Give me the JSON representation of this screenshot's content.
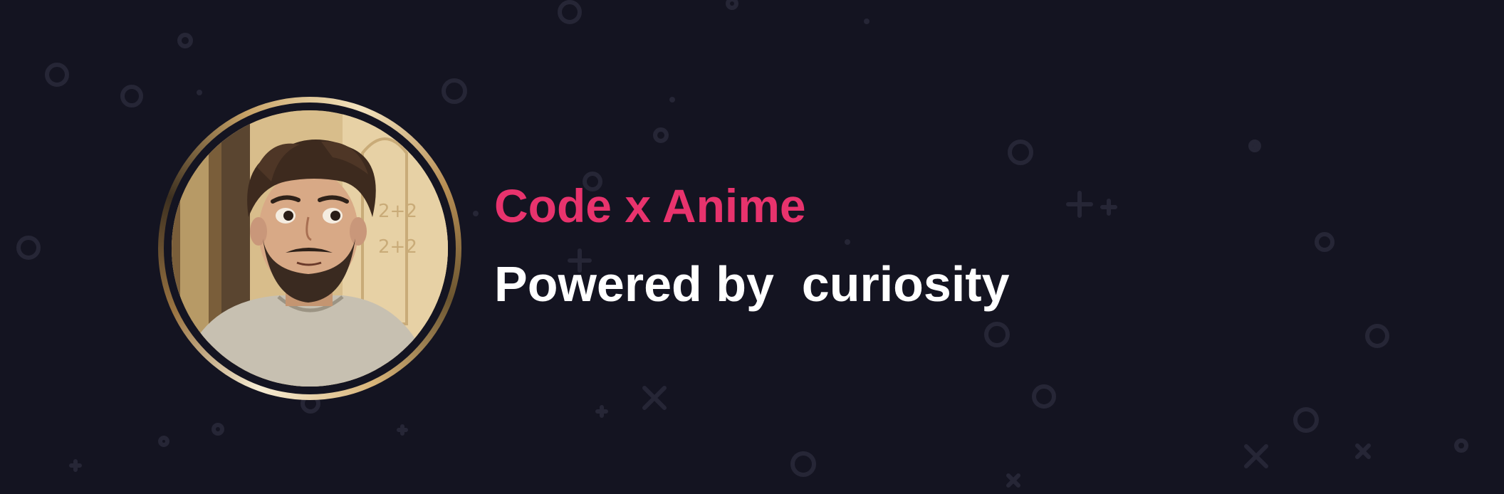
{
  "banner": {
    "title": "Code x Anime",
    "subtitle": "Powered by  curiosity"
  },
  "avatar": {
    "description_icon": "anime-portrait-avatar"
  },
  "colors": {
    "background": "#141421",
    "title": "#e8336d",
    "subtitle": "#ffffff",
    "decoration": "#262636",
    "ring": "#c9a468"
  },
  "decoration": {
    "circle_icon": "circle-outline-icon",
    "cross_icon": "plus-icon"
  }
}
